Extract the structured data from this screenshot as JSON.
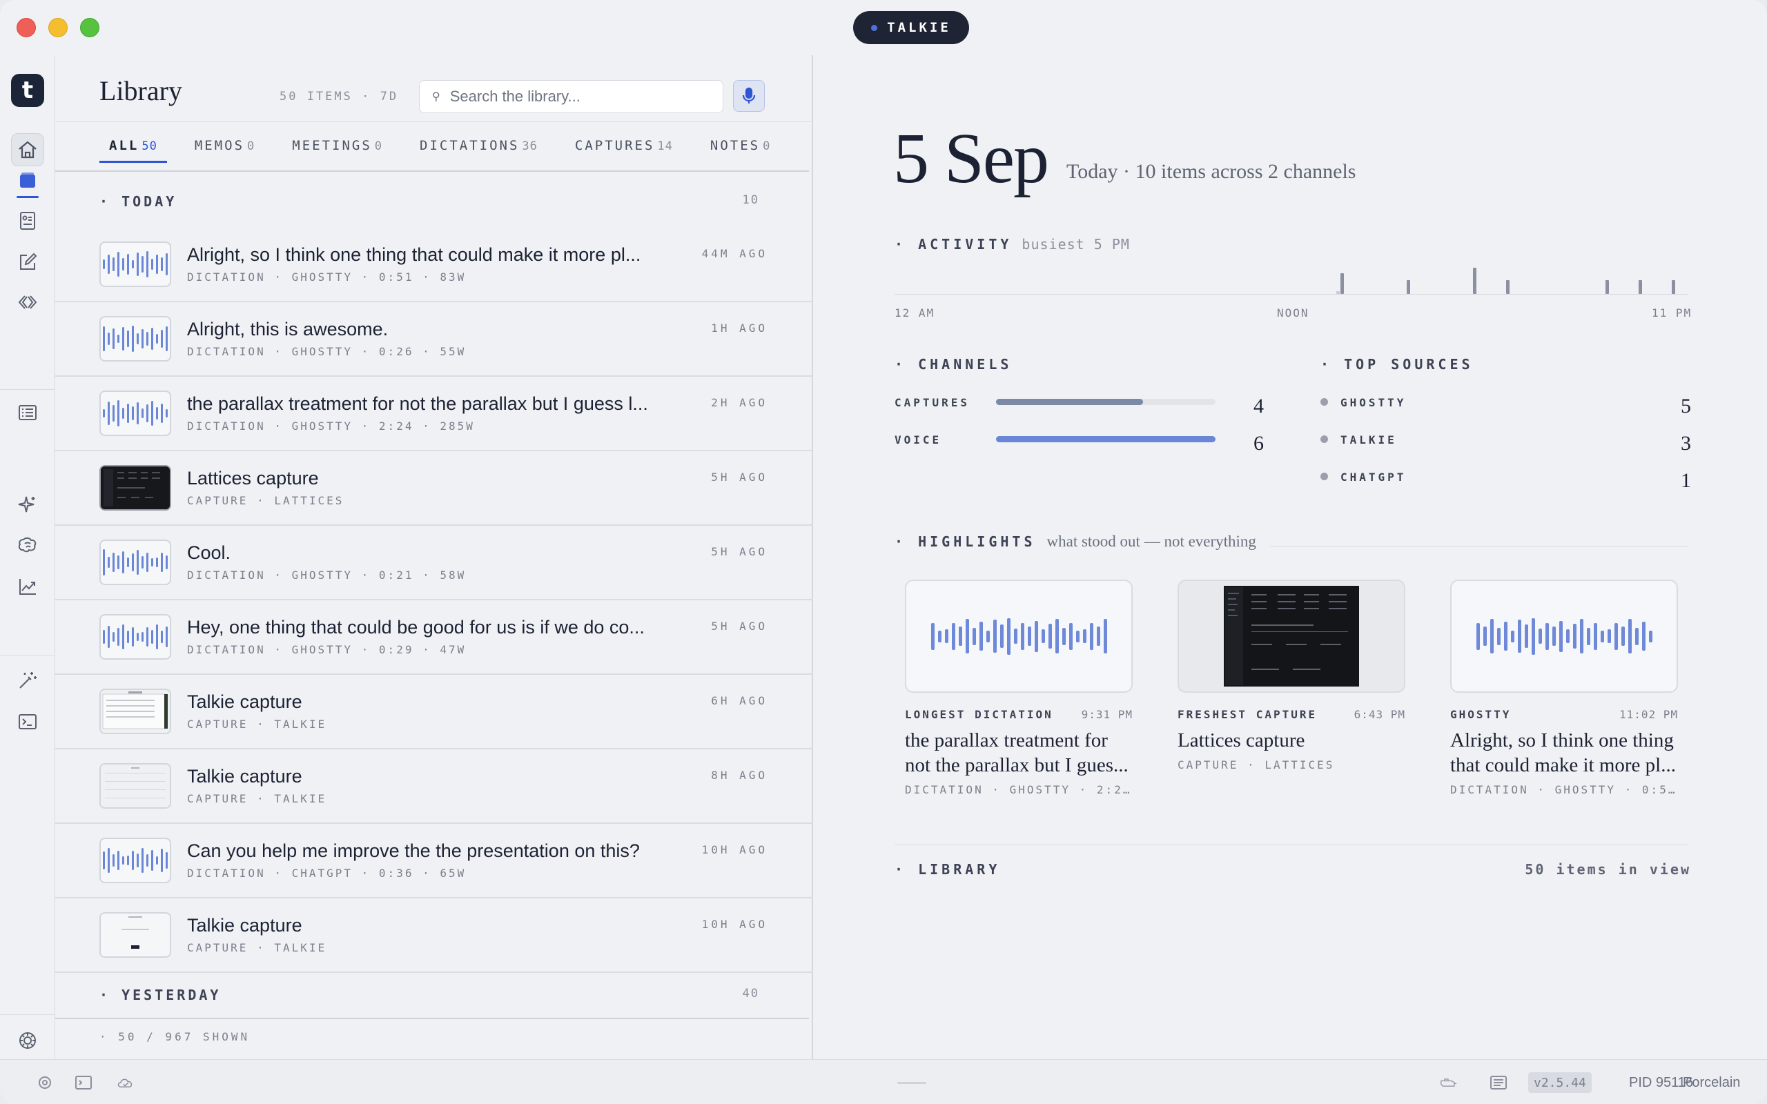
{
  "window": {
    "title_pill": "TALKIE"
  },
  "rail": {
    "logo_letter": "t",
    "icons": [
      "home-icon",
      "library-icon",
      "contacts-icon",
      "compose-icon",
      "code-icon",
      "list-icon",
      "sparkle-icon",
      "brain-icon",
      "chart-icon",
      "wand-icon",
      "terminal-icon",
      "settings-icon"
    ],
    "accent": "#2f55d4"
  },
  "library": {
    "title": "Library",
    "count": "50 ITEMS · 7D",
    "search_placeholder": "Search the library...",
    "tabs": [
      {
        "label": "ALL",
        "count": "50"
      },
      {
        "label": "MEMOS",
        "count": "0"
      },
      {
        "label": "MEETINGS",
        "count": "0"
      },
      {
        "label": "DICTATIONS",
        "count": "36"
      },
      {
        "label": "CAPTURES",
        "count": "14"
      },
      {
        "label": "NOTES",
        "count": "0"
      }
    ],
    "today": {
      "label": "· TODAY",
      "count": "10"
    },
    "yesterday": {
      "label": "· YESTERDAY",
      "count": "40"
    },
    "items": [
      {
        "title": "Alright, so I think one thing that could make it more pl...",
        "meta": "DICTATION · GHOSTTY · 0:51 · 83W",
        "time": "44M AGO",
        "thumb": "wave"
      },
      {
        "title": "Alright, this is awesome.",
        "meta": "DICTATION · GHOSTTY · 0:26 · 55W",
        "time": "1H AGO",
        "thumb": "wave"
      },
      {
        "title": "the parallax treatment for not the parallax but I guess l...",
        "meta": "DICTATION · GHOSTTY · 2:24 · 285W",
        "time": "2H AGO",
        "thumb": "wave"
      },
      {
        "title": "Lattices capture",
        "meta": "CAPTURE · LATTICES",
        "time": "5H AGO",
        "thumb": "dark"
      },
      {
        "title": "Cool.",
        "meta": "DICTATION · GHOSTTY · 0:21 · 58W",
        "time": "5H AGO",
        "thumb": "wave"
      },
      {
        "title": "Hey, one thing that could be good for us is if we do co...",
        "meta": "DICTATION · GHOSTTY · 0:29 · 47W",
        "time": "5H AGO",
        "thumb": "wave"
      },
      {
        "title": "Talkie capture",
        "meta": "CAPTURE · TALKIE",
        "time": "6H AGO",
        "thumb": "shot"
      },
      {
        "title": "Talkie capture",
        "meta": "CAPTURE · TALKIE",
        "time": "8H AGO",
        "thumb": "shot"
      },
      {
        "title": "Can you help me improve the the presentation on this?",
        "meta": "DICTATION · CHATGPT · 0:36 · 65W",
        "time": "10H AGO",
        "thumb": "wave"
      },
      {
        "title": "Talkie capture",
        "meta": "CAPTURE · TALKIE",
        "time": "10H AGO",
        "thumb": "shot"
      }
    ],
    "shown": "· 50 / 967 SHOWN"
  },
  "dashboard": {
    "date": "5 Sep",
    "subtitle": "Today · 10 items across 2 channels",
    "activity": {
      "label": "· ACTIVITY",
      "sub": "busiest 5 PM",
      "axis": [
        "12 AM",
        "NOON",
        "11 PM"
      ]
    },
    "channels": {
      "label": "· CHANNELS",
      "rows": [
        {
          "name": "CAPTURES",
          "value": "4",
          "fraction": 0.67,
          "color": "#7a8aa6"
        },
        {
          "name": "VOICE",
          "value": "6",
          "fraction": 1.0,
          "color": "#6a86d6"
        }
      ]
    },
    "sources": {
      "label": "· TOP SOURCES",
      "rows": [
        {
          "name": "GHOSTTY",
          "value": "5"
        },
        {
          "name": "TALKIE",
          "value": "3"
        },
        {
          "name": "CHATGPT",
          "value": "1"
        }
      ]
    },
    "highlights": {
      "label": "· HIGHLIGHTS",
      "sub": "what stood out — not everything",
      "cards": [
        {
          "kind": "LONGEST DICTATION",
          "time": "9:31 PM",
          "title": "the parallax treatment for not the parallax but I gues...",
          "meta": "DICTATION · GHOSTTY · 2:2...",
          "thumb": "wave"
        },
        {
          "kind": "FRESHEST CAPTURE",
          "time": "6:43 PM",
          "title": "Lattices capture",
          "meta": "CAPTURE · LATTICES",
          "thumb": "shot"
        },
        {
          "kind": "GHOSTTY",
          "time": "11:02 PM",
          "title": "Alright, so I think one thing that could make it more pl...",
          "meta": "DICTATION · GHOSTTY · 0:5...",
          "thumb": "wave"
        }
      ]
    },
    "library_footer": {
      "label": "· LIBRARY",
      "count": "50 items in view"
    }
  },
  "status": {
    "version": "v2.5.44",
    "pid": "PID 95116",
    "theme": "Porcelain"
  }
}
